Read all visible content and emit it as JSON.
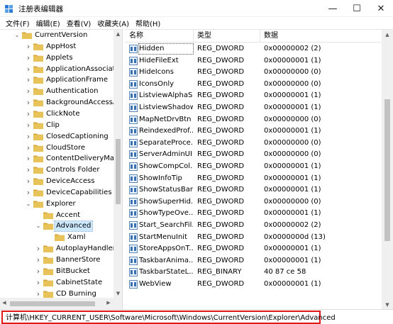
{
  "window": {
    "title": "注册表编辑器",
    "min_glyph": "—",
    "max_glyph": "☐",
    "close_glyph": "✕"
  },
  "menu": [
    "文件(F)",
    "编辑(E)",
    "查看(V)",
    "收藏夹(A)",
    "帮助(H)"
  ],
  "tree": {
    "items": [
      {
        "label": "CurrentVersion",
        "level": 0,
        "expanded": true,
        "has_children": true
      },
      {
        "label": "AppHost",
        "level": 1,
        "expanded": false,
        "has_children": true
      },
      {
        "label": "Applets",
        "level": 1,
        "expanded": false,
        "has_children": true
      },
      {
        "label": "ApplicationAssociatic",
        "level": 1,
        "expanded": false,
        "has_children": true
      },
      {
        "label": "ApplicationFrame",
        "level": 1,
        "expanded": false,
        "has_children": true
      },
      {
        "label": "Authentication",
        "level": 1,
        "expanded": false,
        "has_children": true
      },
      {
        "label": "BackgroundAccessAp",
        "level": 1,
        "expanded": false,
        "has_children": true
      },
      {
        "label": "ClickNote",
        "level": 1,
        "expanded": false,
        "has_children": true
      },
      {
        "label": "Clip",
        "level": 1,
        "expanded": false,
        "has_children": true
      },
      {
        "label": "ClosedCaptioning",
        "level": 1,
        "expanded": false,
        "has_children": true
      },
      {
        "label": "CloudStore",
        "level": 1,
        "expanded": false,
        "has_children": true
      },
      {
        "label": "ContentDeliveryMana",
        "level": 1,
        "expanded": false,
        "has_children": true
      },
      {
        "label": "Controls Folder",
        "level": 1,
        "expanded": false,
        "has_children": true
      },
      {
        "label": "DeviceAccess",
        "level": 1,
        "expanded": false,
        "has_children": true
      },
      {
        "label": "DeviceCapabilities",
        "level": 1,
        "expanded": false,
        "has_children": true
      },
      {
        "label": "Explorer",
        "level": 1,
        "expanded": true,
        "has_children": true
      },
      {
        "label": "Accent",
        "level": 2,
        "expanded": false,
        "has_children": false
      },
      {
        "label": "Advanced",
        "level": 2,
        "expanded": true,
        "has_children": true,
        "selected": true
      },
      {
        "label": "Xaml",
        "level": 3,
        "expanded": false,
        "has_children": false
      },
      {
        "label": "AutoplayHandlers",
        "level": 2,
        "expanded": false,
        "has_children": true
      },
      {
        "label": "BannerStore",
        "level": 2,
        "expanded": false,
        "has_children": true
      },
      {
        "label": "BitBucket",
        "level": 2,
        "expanded": false,
        "has_children": true
      },
      {
        "label": "CabinetState",
        "level": 2,
        "expanded": false,
        "has_children": true
      },
      {
        "label": "CD Burning",
        "level": 2,
        "expanded": false,
        "has_children": true
      }
    ]
  },
  "list": {
    "columns": [
      "名称",
      "类型",
      "数据"
    ],
    "rows": [
      {
        "name": "Hidden",
        "type": "REG_DWORD",
        "data": "0x00000002 (2)",
        "focused": true
      },
      {
        "name": "HideFileExt",
        "type": "REG_DWORD",
        "data": "0x00000001 (1)"
      },
      {
        "name": "HideIcons",
        "type": "REG_DWORD",
        "data": "0x00000000 (0)"
      },
      {
        "name": "IconsOnly",
        "type": "REG_DWORD",
        "data": "0x00000000 (0)"
      },
      {
        "name": "ListviewAlphaS...",
        "type": "REG_DWORD",
        "data": "0x00000001 (1)"
      },
      {
        "name": "ListviewShadow",
        "type": "REG_DWORD",
        "data": "0x00000001 (1)"
      },
      {
        "name": "MapNetDrvBtn",
        "type": "REG_DWORD",
        "data": "0x00000000 (0)"
      },
      {
        "name": "ReindexedProf...",
        "type": "REG_DWORD",
        "data": "0x00000001 (1)"
      },
      {
        "name": "SeparateProce...",
        "type": "REG_DWORD",
        "data": "0x00000000 (0)"
      },
      {
        "name": "ServerAdminUI",
        "type": "REG_DWORD",
        "data": "0x00000000 (0)"
      },
      {
        "name": "ShowCompCol...",
        "type": "REG_DWORD",
        "data": "0x00000001 (1)"
      },
      {
        "name": "ShowInfoTip",
        "type": "REG_DWORD",
        "data": "0x00000001 (1)"
      },
      {
        "name": "ShowStatusBar",
        "type": "REG_DWORD",
        "data": "0x00000001 (1)"
      },
      {
        "name": "ShowSuperHid...",
        "type": "REG_DWORD",
        "data": "0x00000000 (0)"
      },
      {
        "name": "ShowTypeOve...",
        "type": "REG_DWORD",
        "data": "0x00000001 (1)"
      },
      {
        "name": "Start_SearchFil...",
        "type": "REG_DWORD",
        "data": "0x00000002 (2)"
      },
      {
        "name": "StartMenuInit",
        "type": "REG_DWORD",
        "data": "0x0000000d (13)"
      },
      {
        "name": "StoreAppsOnT...",
        "type": "REG_DWORD",
        "data": "0x00000001 (1)"
      },
      {
        "name": "TaskbarAnima...",
        "type": "REG_DWORD",
        "data": "0x00000001 (1)"
      },
      {
        "name": "TaskbarStateL...",
        "type": "REG_BINARY",
        "data": "40 87 ce 58"
      },
      {
        "name": "WebView",
        "type": "REG_DWORD",
        "data": "0x00000001 (1)"
      }
    ]
  },
  "status": {
    "path": "计算机\\HKEY_CURRENT_USER\\Software\\Microsoft\\Windows\\CurrentVersion\\Explorer\\Advanced"
  },
  "colors": {
    "folder": "#e8c35a",
    "folder_dark": "#d4a83a",
    "selection": "#cce8ff",
    "status_border": "#e01818"
  }
}
